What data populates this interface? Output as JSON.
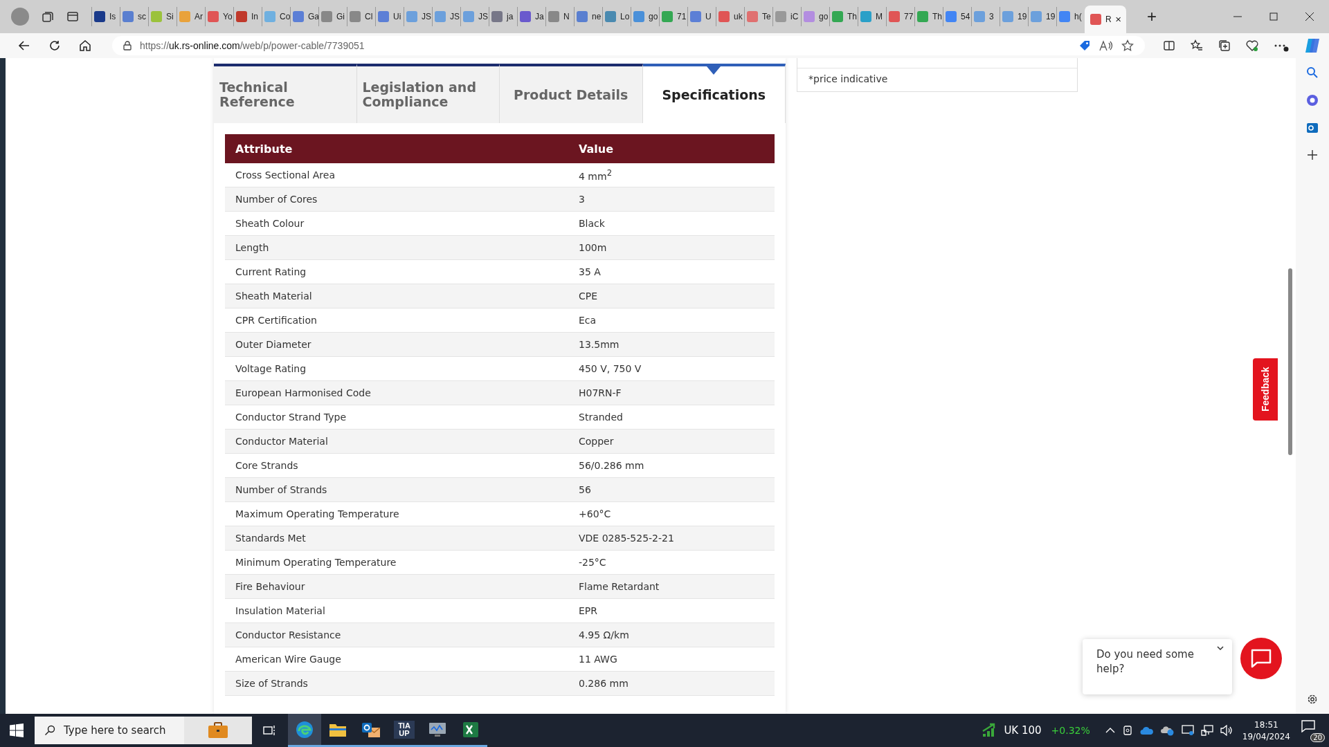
{
  "browser": {
    "tabs": [
      {
        "label": "Is",
        "color": "#1a3a8a",
        "selected": false
      },
      {
        "label": "sc",
        "color": "#5a7fd0",
        "selected": false
      },
      {
        "label": "Si",
        "color": "#9bc23c",
        "selected": false
      },
      {
        "label": "Ar",
        "color": "#e9a23b",
        "selected": false
      },
      {
        "label": "Yo",
        "color": "#e05555",
        "selected": false
      },
      {
        "label": "In",
        "color": "#c0392b",
        "selected": false
      },
      {
        "label": "Co",
        "color": "#6fb0e0",
        "selected": false
      },
      {
        "label": "Ga",
        "color": "#5c7fd6",
        "selected": false
      },
      {
        "label": "Gi",
        "color": "#888888",
        "selected": false
      },
      {
        "label": "Cl",
        "color": "#888888",
        "selected": false
      },
      {
        "label": "Ui",
        "color": "#5c7fd6",
        "selected": false
      },
      {
        "label": "JS",
        "color": "#6ca0dc",
        "selected": false
      },
      {
        "label": "JS",
        "color": "#6ca0dc",
        "selected": false
      },
      {
        "label": "JS",
        "color": "#6ca0dc",
        "selected": false
      },
      {
        "label": "ja",
        "color": "#777788",
        "selected": false
      },
      {
        "label": "Ja",
        "color": "#6a5acd",
        "selected": false
      },
      {
        "label": "N",
        "color": "#888888",
        "selected": false
      },
      {
        "label": "ne",
        "color": "#5a7fd0",
        "selected": false
      },
      {
        "label": "Lo",
        "color": "#4a8ab0",
        "selected": false
      },
      {
        "label": "go",
        "color": "#4a90d9",
        "selected": false
      },
      {
        "label": "71",
        "color": "#34a853",
        "selected": false
      },
      {
        "label": "U",
        "color": "#5c7fd6",
        "selected": false
      },
      {
        "label": "uk",
        "color": "#e05555",
        "selected": false
      },
      {
        "label": "Te",
        "color": "#e07070",
        "selected": false
      },
      {
        "label": "iC",
        "color": "#999999",
        "selected": false
      },
      {
        "label": "go",
        "color": "#b38de0",
        "selected": false
      },
      {
        "label": "Th",
        "color": "#34a853",
        "selected": false
      },
      {
        "label": "M",
        "color": "#2aa0c8",
        "selected": false
      },
      {
        "label": "77",
        "color": "#e05555",
        "selected": false
      },
      {
        "label": "Th",
        "color": "#34a853",
        "selected": false
      },
      {
        "label": "54",
        "color": "#4285f4",
        "selected": false
      },
      {
        "label": "3",
        "color": "#6ca0dc",
        "selected": false
      },
      {
        "label": "19",
        "color": "#6ca0dc",
        "selected": false
      },
      {
        "label": "19",
        "color": "#6ca0dc",
        "selected": false
      },
      {
        "label": "h(",
        "color": "#4285f4",
        "selected": false
      },
      {
        "label": "R",
        "color": "#e05555",
        "selected": true
      }
    ],
    "new_tab": "+",
    "url": {
      "host": "uk.rs-online.com",
      "path": "/web/p/power-cable/7739051",
      "scheme": "https://"
    }
  },
  "page": {
    "tabs": [
      {
        "label": "Technical Reference",
        "selected": false
      },
      {
        "label": "Legislation and Compliance",
        "selected": false
      },
      {
        "label": "Product Details",
        "selected": false
      },
      {
        "label": "Specifications",
        "selected": true
      }
    ],
    "table": {
      "columns": [
        "Attribute",
        "Value"
      ],
      "rows": [
        [
          "Cross Sectional Area",
          "4 mm$^{2}$"
        ],
        [
          "Number of Cores",
          "3"
        ],
        [
          "Sheath Colour",
          "Black"
        ],
        [
          "Length",
          "100m"
        ],
        [
          "Current Rating",
          "35 A"
        ],
        [
          "Sheath Material",
          "CPE"
        ],
        [
          "CPR Certification",
          "Eca"
        ],
        [
          "Outer Diameter",
          "13.5mm"
        ],
        [
          "Voltage Rating",
          "450 V, 750 V"
        ],
        [
          "European Harmonised Code",
          "H07RN-F"
        ],
        [
          "Conductor Strand Type",
          "Stranded"
        ],
        [
          "Conductor Material",
          "Copper"
        ],
        [
          "Core Strands",
          "56/0.286 mm"
        ],
        [
          "Number of Strands",
          "56"
        ],
        [
          "Maximum Operating Temperature",
          "+60°C"
        ],
        [
          "Standards Met",
          "VDE 0285-525-2-21"
        ],
        [
          "Minimum Operating Temperature",
          "-25°C"
        ],
        [
          "Fire Behaviour",
          "Flame Retardant"
        ],
        [
          "Insulation Material",
          "EPR"
        ],
        [
          "Conductor Resistance",
          "4.95 Ω/km"
        ],
        [
          "American Wire Gauge",
          "11 AWG"
        ],
        [
          "Size of Strands",
          "0.286 mm"
        ]
      ]
    },
    "price_note": "*price indicative",
    "feedback": "Feedback",
    "chat": {
      "message": "Do you need some help?"
    }
  },
  "taskbar": {
    "search": {
      "placeholder": "Type here to search"
    },
    "apps": [
      {
        "kind": "edge",
        "selected": true
      },
      {
        "kind": "folder",
        "selected": false
      },
      {
        "kind": "outlook",
        "selected": false
      },
      {
        "kind": "tia",
        "label": "TIA UP",
        "selected": false
      },
      {
        "kind": "monitor",
        "selected": false
      },
      {
        "kind": "excel",
        "selected": false
      }
    ],
    "ticker": {
      "name": "UK 100",
      "change": "+0.32%"
    },
    "time": "18:51",
    "date": "19/04/2024",
    "notifications": "20"
  }
}
